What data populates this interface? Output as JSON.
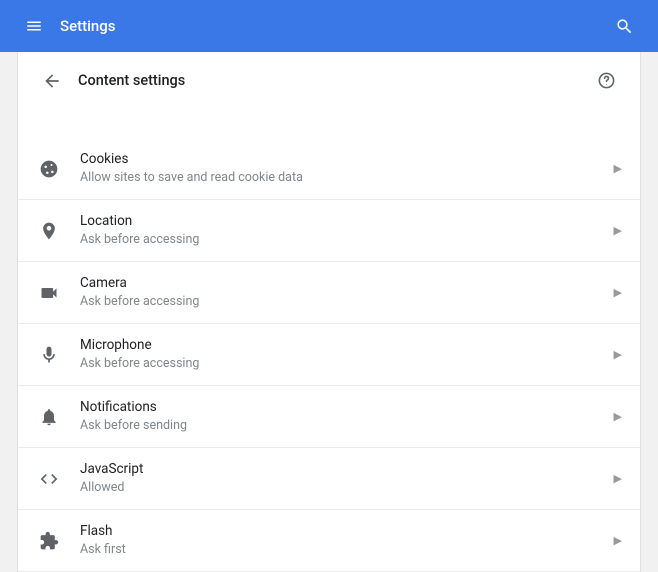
{
  "topbar": {
    "title": "Settings"
  },
  "page": {
    "title": "Content settings"
  },
  "items": [
    {
      "title": "Cookies",
      "subtitle": "Allow sites to save and read cookie data"
    },
    {
      "title": "Location",
      "subtitle": "Ask before accessing"
    },
    {
      "title": "Camera",
      "subtitle": "Ask before accessing"
    },
    {
      "title": "Microphone",
      "subtitle": "Ask before accessing"
    },
    {
      "title": "Notifications",
      "subtitle": "Ask before sending"
    },
    {
      "title": "JavaScript",
      "subtitle": "Allowed"
    },
    {
      "title": "Flash",
      "subtitle": "Ask first"
    }
  ]
}
